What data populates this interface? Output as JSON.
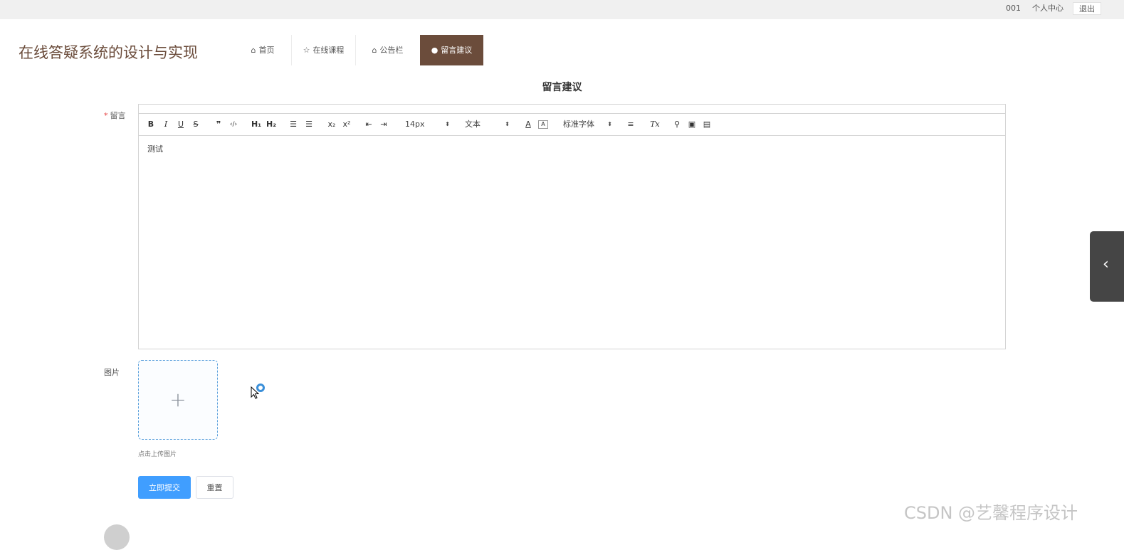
{
  "topbar": {
    "user": "001",
    "personal_center": "个人中心",
    "logout": "退出"
  },
  "site": {
    "title": "在线答疑系统的设计与实现"
  },
  "nav": {
    "items": [
      {
        "label": "首页",
        "icon": "home-icon"
      },
      {
        "label": "在线课程",
        "icon": "star-icon"
      },
      {
        "label": "公告栏",
        "icon": "bag-icon"
      },
      {
        "label": "留言建议",
        "icon": "info-circle-icon",
        "active": true
      }
    ]
  },
  "page": {
    "heading": "留言建议"
  },
  "form": {
    "message_label": "留言",
    "required_mark": "*",
    "image_label": "图片",
    "upload_tip": "点击上传图片",
    "submit_label": "立即提交",
    "reset_label": "重置"
  },
  "editor": {
    "content": "测试",
    "toolbar": {
      "bold": "B",
      "italic": "I",
      "underline": "U",
      "strike": "S",
      "blockquote": "❞",
      "code": "‹/›",
      "h1": "H₁",
      "h2": "H₂",
      "ordered_list": "☰",
      "bullet_list": "☰",
      "subscript": "x₂",
      "superscript": "x²",
      "indent_decrease": "⇤",
      "indent_increase": "⇥",
      "size_value": "14px",
      "header_value": "文本",
      "font_color": "A",
      "background_color": "A",
      "font_family_value": "标准字体",
      "align": "≡",
      "clean": "Tx",
      "link": "⚲",
      "image": "▣",
      "video": "▤",
      "select_arrow": "⬍"
    }
  },
  "watermark": "CSDN @艺馨程序设计"
}
